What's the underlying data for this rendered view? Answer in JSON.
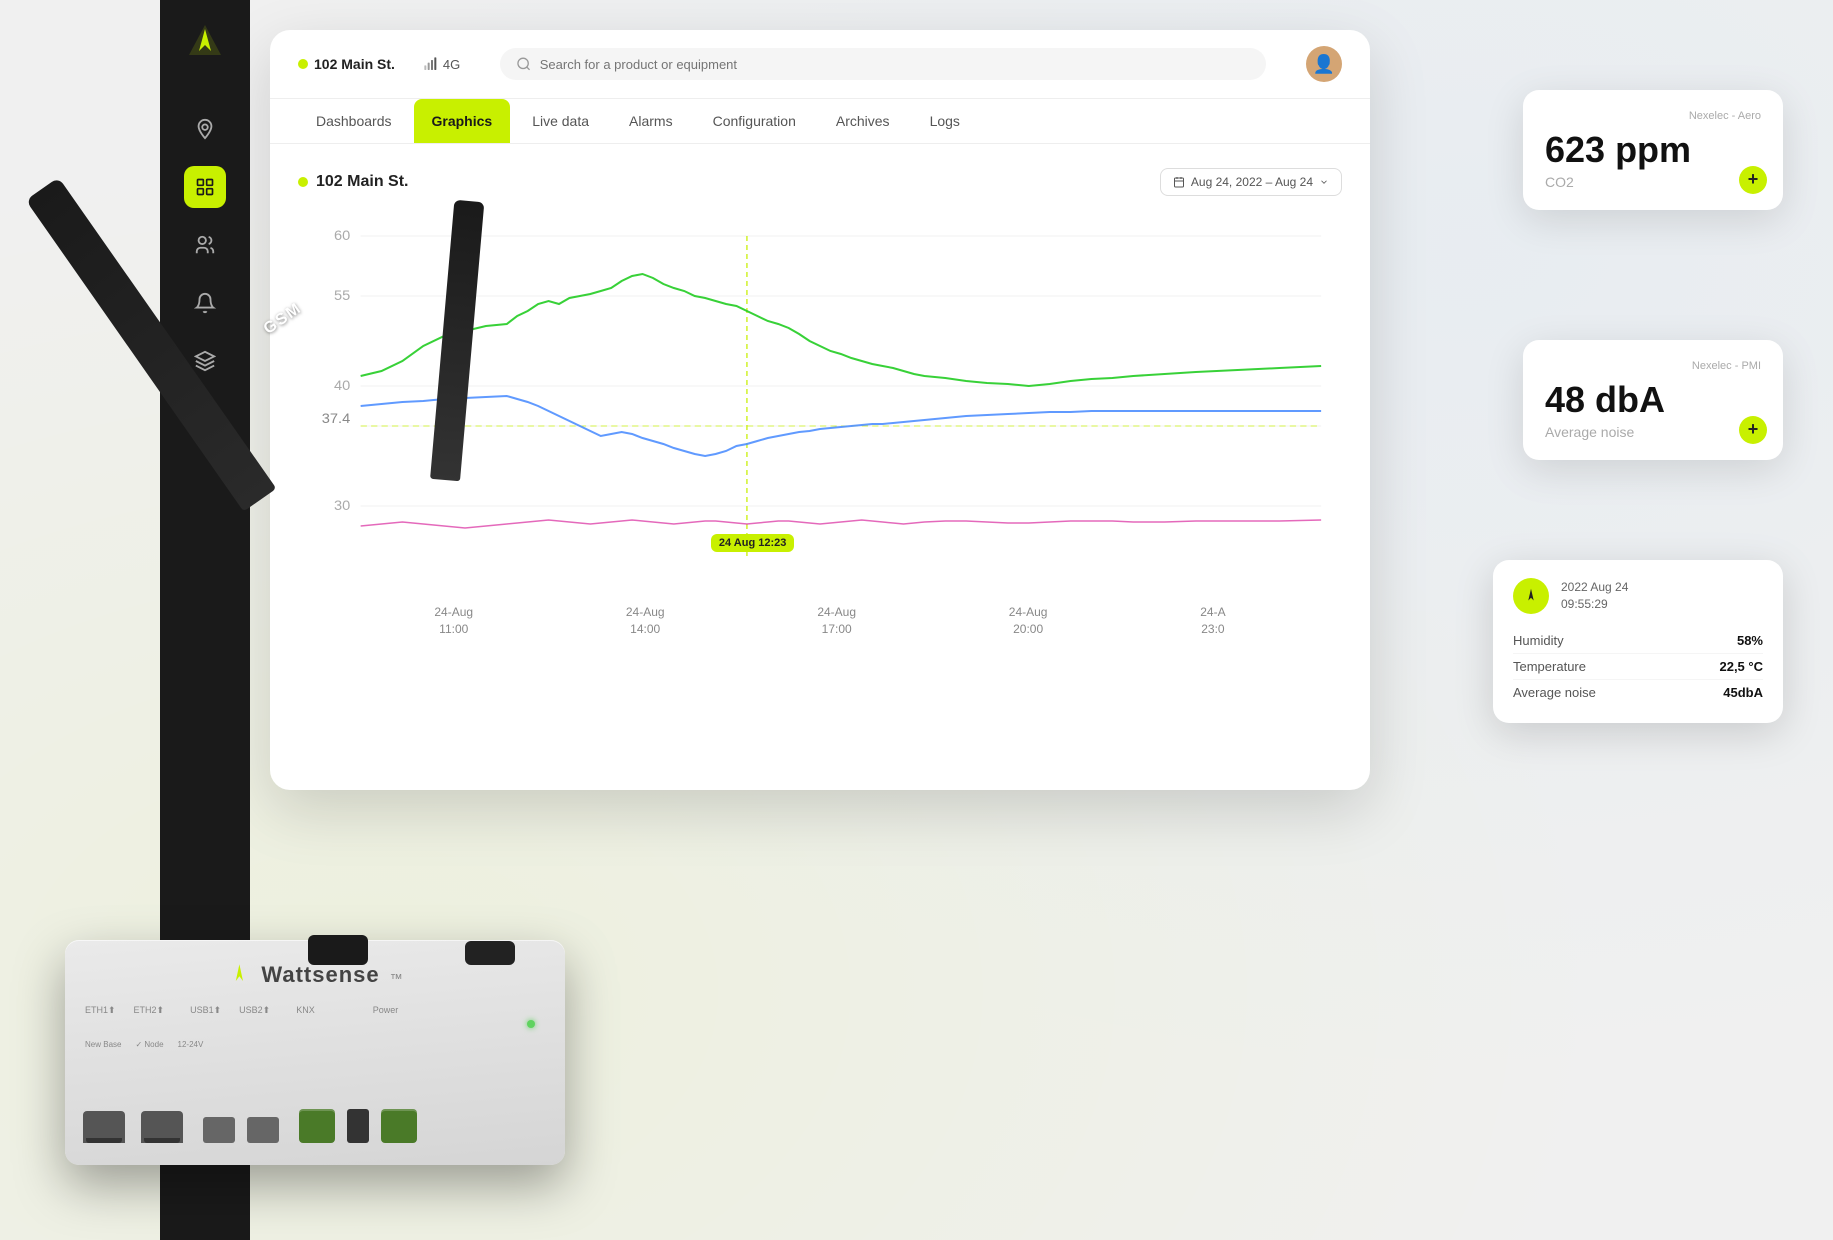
{
  "sidebar": {
    "icons": [
      "location-icon",
      "grid-icon",
      "users-icon",
      "bell-icon",
      "layers-icon",
      "server-icon"
    ]
  },
  "header": {
    "location": "102 Main St.",
    "signal": "4G",
    "search_placeholder": "Search for a product or equipment"
  },
  "nav": {
    "tabs": [
      {
        "label": "Dashboards",
        "active": false
      },
      {
        "label": "Graphics",
        "active": true
      },
      {
        "label": "Live data",
        "active": false
      },
      {
        "label": "Alarms",
        "active": false
      },
      {
        "label": "Configuration",
        "active": false
      },
      {
        "label": "Archives",
        "active": false
      },
      {
        "label": "Logs",
        "active": false
      }
    ]
  },
  "chart": {
    "title": "102 Main St.",
    "date_range": "Aug 24, 2022 – Aug 24",
    "y_labels": [
      "60",
      "55",
      "40",
      "37.4",
      "30"
    ],
    "x_labels": [
      "24-Aug\n11:00",
      "24-Aug\n14:00",
      "24-Aug\n17:00",
      "24-Aug\n20:00",
      "24-A\n23:0"
    ],
    "cursor_label": "24 Aug 12:23"
  },
  "card_co2": {
    "source": "Nexelec - Aero",
    "value": "623 ppm",
    "unit": "CO2",
    "plus_label": "+"
  },
  "card_noise": {
    "source": "Nexelec - PMI",
    "value": "48 dbA",
    "unit": "Average noise",
    "plus_label": "+"
  },
  "tooltip": {
    "date": "2022 Aug 24",
    "time": "09:55:29",
    "rows": [
      {
        "label": "Humidity",
        "value": "58%"
      },
      {
        "label": "Temperature",
        "value": "22,5 °C"
      },
      {
        "label": "Average noise",
        "value": "45dbA"
      }
    ]
  },
  "device": {
    "brand": "Wattsense"
  }
}
